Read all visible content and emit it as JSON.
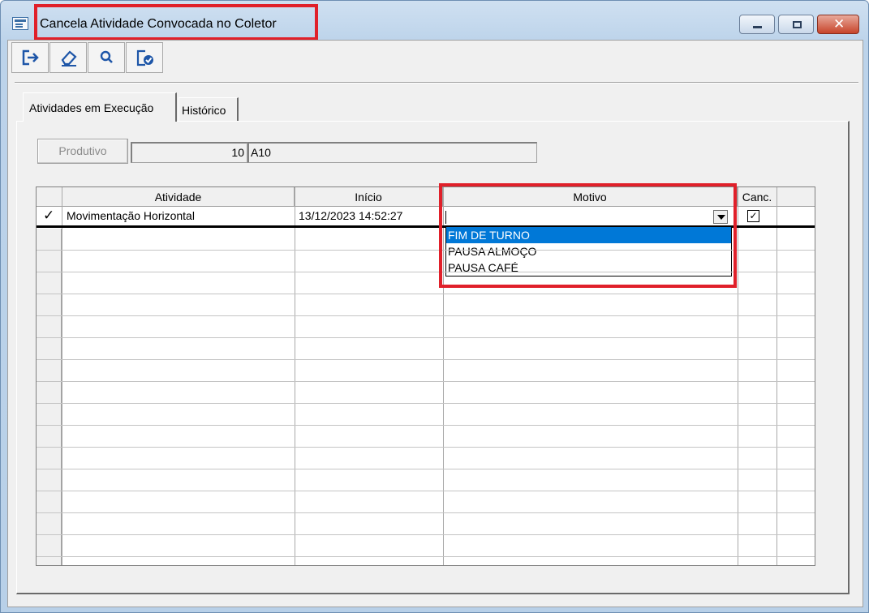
{
  "window": {
    "title": "Cancela Atividade Convocada no Coletor",
    "close_glyph": "✕"
  },
  "toolbar": {
    "buttons": [
      {
        "icon": "exit-icon"
      },
      {
        "icon": "eraser-icon"
      },
      {
        "icon": "search-icon"
      },
      {
        "icon": "confirm-document-icon"
      }
    ]
  },
  "tabs": [
    {
      "label": "Atividades em Execução",
      "active": true
    },
    {
      "label": "Histórico",
      "active": false
    }
  ],
  "filter": {
    "button_label": "Produtivo",
    "code": "10",
    "description": "A10"
  },
  "grid": {
    "columns": [
      "Atividade",
      "Início",
      "Motivo",
      "Canc."
    ],
    "rows": [
      {
        "indicator": "✓",
        "atividade": "Movimentação Horizontal",
        "inicio": "13/12/2023 14:52:27",
        "motivo": "",
        "canc_checked": true,
        "canc_mark": "✓"
      }
    ],
    "empty_rows": 16
  },
  "motivo_dropdown": {
    "options": [
      "FIM DE TURNO",
      "PAUSA ALMOÇO",
      "PAUSA CAFÉ"
    ],
    "selected_index": 0
  },
  "colors": {
    "highlight": "#e0202a",
    "selection": "#0078d7",
    "window_frame": "#bcd3ea"
  }
}
